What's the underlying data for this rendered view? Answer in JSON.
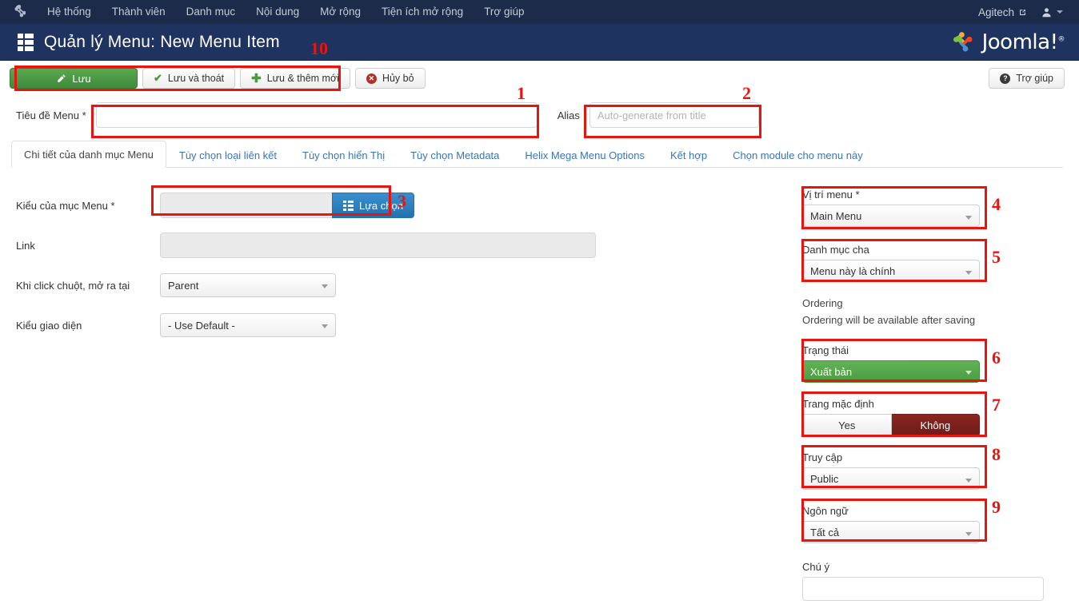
{
  "navbar": {
    "brand_icon": "joomla-brand-icon",
    "items": [
      {
        "label": "Hệ thống"
      },
      {
        "label": "Thành viên"
      },
      {
        "label": "Danh mục"
      },
      {
        "label": "Nội dung"
      },
      {
        "label": "Mở rộng"
      },
      {
        "label": "Tiện ích mở rộng"
      },
      {
        "label": "Trợ giúp"
      }
    ],
    "site_name": "Agitech",
    "site_icon": "external-link-icon",
    "user_icon": "user-icon",
    "user_caret_icon": "chevron-down-icon"
  },
  "header": {
    "title": "Quản lý Menu: New Menu Item",
    "title_icon": "menu-list-icon",
    "logo_text": "Joomla!",
    "logo_reg": "®"
  },
  "toolbar": {
    "save_label": "Lưu",
    "save_icon": "pencil-icon",
    "save_close_label": "Lưu và thoát",
    "save_close_icon": "check-icon",
    "save_new_label": "Lưu & thêm mới",
    "save_new_icon": "plus-icon",
    "cancel_label": "Hủy bỏ",
    "cancel_icon": "close-circle-icon",
    "help_label": "Trợ giúp",
    "help_icon": "question-circle-icon"
  },
  "title_row": {
    "menu_title_label": "Tiêu đề Menu *",
    "menu_title_value": "",
    "menu_title_placeholder": "",
    "alias_label": "Alias",
    "alias_value": "",
    "alias_placeholder": "Auto-generate from title"
  },
  "tabs": [
    {
      "label": "Chi tiết của danh mục Menu",
      "active": true
    },
    {
      "label": "Tùy chọn loại liên kết",
      "active": false
    },
    {
      "label": "Tùy chọn hiển Thị",
      "active": false
    },
    {
      "label": "Tùy chọn Metadata",
      "active": false
    },
    {
      "label": "Helix Mega Menu Options",
      "active": false
    },
    {
      "label": "Kết hợp",
      "active": false
    },
    {
      "label": "Chọn module cho menu này",
      "active": false
    }
  ],
  "form": {
    "menu_type_label": "Kiểu của mục Menu *",
    "menu_type_value": "",
    "select_button_label": "Lựa chọn",
    "select_button_icon": "list-icon",
    "link_label": "Link",
    "link_value": "",
    "target_label": "Khi click chuột, mở ra tại",
    "target_value": "Parent",
    "template_style_label": "Kiểu giao diện",
    "template_style_value": "- Use Default -"
  },
  "sidebar": {
    "menu_location_label": "Vị trí menu *",
    "menu_location_value": "Main Menu",
    "parent_label": "Danh mục cha",
    "parent_value": "Menu này là chính",
    "ordering_label": "Ordering",
    "ordering_note": "Ordering will be available after saving",
    "status_label": "Trạng thái",
    "status_value": "Xuất bản",
    "default_page_label": "Trang mặc định",
    "default_yes_label": "Yes",
    "default_no_label": "Không",
    "access_label": "Truy cập",
    "access_value": "Public",
    "language_label": "Ngôn ngữ",
    "language_value": "Tất cả",
    "note_label": "Chú ý",
    "note_value": ""
  },
  "annotations": [
    {
      "num": "1"
    },
    {
      "num": "2"
    },
    {
      "num": "3"
    },
    {
      "num": "4"
    },
    {
      "num": "5"
    },
    {
      "num": "6"
    },
    {
      "num": "7"
    },
    {
      "num": "8"
    },
    {
      "num": "9"
    },
    {
      "num": "10"
    }
  ],
  "colors": {
    "navbar_bg": "#1c2b4a",
    "subhead_bg": "#1f3361",
    "accent_green": "#3d8b3d",
    "accent_blue": "#2272ad",
    "accent_red": "#6e1c18",
    "annotation_red": "#e8140f"
  }
}
